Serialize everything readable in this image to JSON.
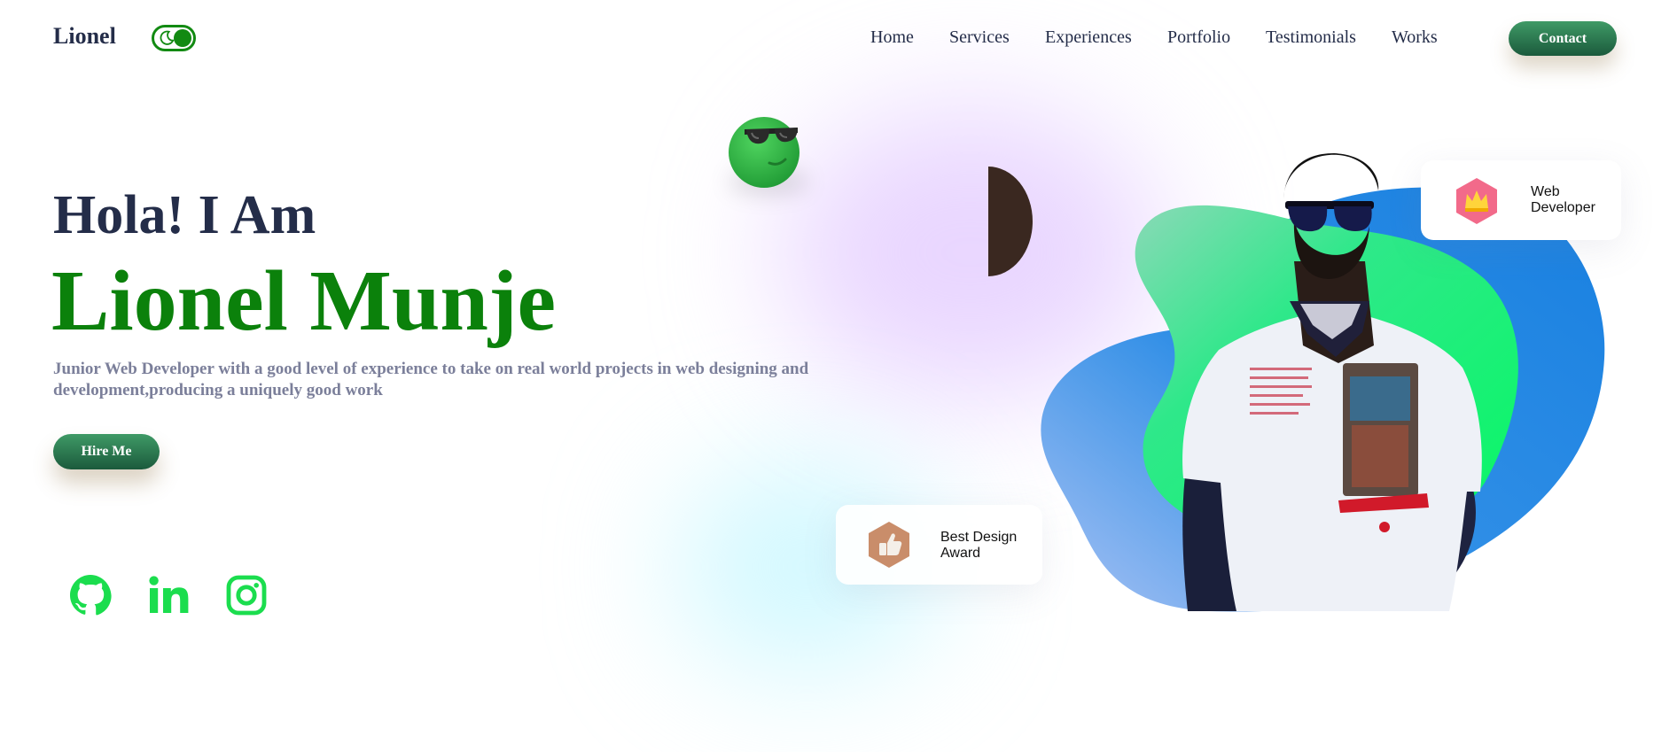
{
  "header": {
    "logo": "Lionel",
    "theme_toggle": {
      "state": "dark-mode-on",
      "icon": "moon-icon"
    },
    "nav": [
      "Home",
      "Services",
      "Experiences",
      "Portfolio",
      "Testimonials",
      "Works"
    ],
    "contact_label": "Contact"
  },
  "hero": {
    "greeting": "Hola! I Am",
    "name": "Lionel Munje",
    "description": "Junior Web Developer with a good level of experience to take on real world projects in web designing and development,producing a uniquely good work",
    "hire_label": "Hire Me",
    "socials": [
      {
        "icon": "github-icon"
      },
      {
        "icon": "linkedin-icon"
      },
      {
        "icon": "instagram-icon"
      }
    ]
  },
  "cards": {
    "web": {
      "line1": "Web",
      "line2": "Developer",
      "icon": "crown-icon"
    },
    "award": {
      "line1": "Best Design",
      "line2": "Award",
      "icon": "thumbs-up-icon"
    }
  },
  "colors": {
    "primary_green": "#0b810b",
    "social_green": "#1bdd4e",
    "button_gradient_top": "#3f9a66",
    "button_gradient_bottom": "#1b5a3c",
    "heading": "#242d49",
    "muted": "#7b7f9a",
    "blob_blue": "#1c86e6",
    "blob_green": "#10f06a"
  }
}
